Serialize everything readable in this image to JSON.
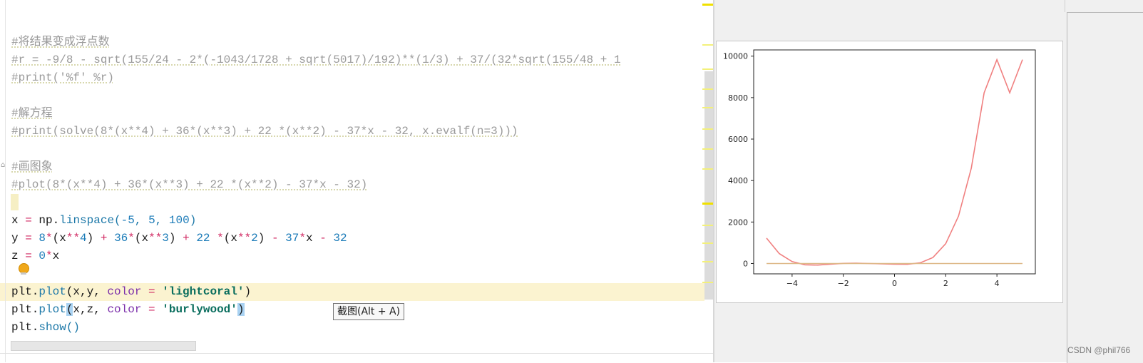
{
  "editor": {
    "code_lines": [
      [
        {
          "t": "",
          "c": "pl"
        }
      ],
      [
        {
          "t": "#将结果变成浮点数",
          "c": "cm"
        }
      ],
      [
        {
          "t": "#r = -9/8 - sqrt(155/24 - 2*(-1043/1728 + sqrt(5017)/192)**(1/3) + 37/(32*sqrt(155/48 + 1",
          "c": "cm"
        }
      ],
      [
        {
          "t": "#print('%f' %r)",
          "c": "cm"
        }
      ],
      [
        {
          "t": "",
          "c": "pl"
        }
      ],
      [
        {
          "t": "#解方程",
          "c": "cm"
        }
      ],
      [
        {
          "t": "#print(solve(8*(x**4) + 36*(x**3) + 22 *(x**2) - 37*x - 32, x.evalf(n=3)))",
          "c": "cm"
        }
      ],
      [
        {
          "t": "",
          "c": "pl"
        }
      ],
      [
        {
          "t": "#画图象",
          "c": "cm"
        }
      ],
      [
        {
          "t": "#plot(8*(x**4) + 36*(x**3) + 22 *(x**2) - 37*x - 32)",
          "c": "cm"
        }
      ],
      [
        {
          "t": "",
          "c": "pl"
        }
      ],
      [
        {
          "t": "x",
          "c": "pl"
        },
        {
          "t": " ",
          "c": "pl"
        },
        {
          "t": "=",
          "c": "op"
        },
        {
          "t": " np.",
          "c": "pl"
        },
        {
          "t": "linspace",
          "c": "fn"
        },
        {
          "t": "(",
          "c": "fn"
        },
        {
          "t": "-5",
          "c": "num"
        },
        {
          "t": ", ",
          "c": "fn"
        },
        {
          "t": "5",
          "c": "num"
        },
        {
          "t": ", ",
          "c": "fn"
        },
        {
          "t": "100",
          "c": "num"
        },
        {
          "t": ")",
          "c": "fn"
        }
      ],
      [
        {
          "t": "y",
          "c": "pl"
        },
        {
          "t": " = ",
          "c": "op"
        },
        {
          "t": "8",
          "c": "num"
        },
        {
          "t": "*",
          "c": "op"
        },
        {
          "t": "(x",
          "c": "pl"
        },
        {
          "t": "**",
          "c": "op"
        },
        {
          "t": "4",
          "c": "num"
        },
        {
          "t": ")",
          "c": "pl"
        },
        {
          "t": " + ",
          "c": "op"
        },
        {
          "t": "36",
          "c": "num"
        },
        {
          "t": "*",
          "c": "op"
        },
        {
          "t": "(x",
          "c": "pl"
        },
        {
          "t": "**",
          "c": "op"
        },
        {
          "t": "3",
          "c": "num"
        },
        {
          "t": ")",
          "c": "pl"
        },
        {
          "t": " + ",
          "c": "op"
        },
        {
          "t": "22",
          "c": "num"
        },
        {
          "t": " *",
          "c": "op"
        },
        {
          "t": "(x",
          "c": "pl"
        },
        {
          "t": "**",
          "c": "op"
        },
        {
          "t": "2",
          "c": "num"
        },
        {
          "t": ")",
          "c": "pl"
        },
        {
          "t": " - ",
          "c": "op"
        },
        {
          "t": "37",
          "c": "num"
        },
        {
          "t": "*",
          "c": "op"
        },
        {
          "t": "x",
          "c": "pl"
        },
        {
          "t": " - ",
          "c": "op"
        },
        {
          "t": "32",
          "c": "num"
        }
      ],
      [
        {
          "t": "z",
          "c": "pl"
        },
        {
          "t": " = ",
          "c": "op"
        },
        {
          "t": "0",
          "c": "num"
        },
        {
          "t": "*",
          "c": "op"
        },
        {
          "t": "x",
          "c": "pl"
        }
      ],
      [
        {
          "t": "",
          "c": "pl"
        }
      ],
      [
        {
          "t": "plt.",
          "c": "pl"
        },
        {
          "t": "plot",
          "c": "fn"
        },
        {
          "t": "(x,y, ",
          "c": "pl"
        },
        {
          "t": "color",
          "c": "param"
        },
        {
          "t": " = ",
          "c": "op"
        },
        {
          "t": "'lightcoral'",
          "c": "str"
        },
        {
          "t": ")",
          "c": "pl"
        }
      ],
      [
        {
          "t": "plt.",
          "c": "pl"
        },
        {
          "t": "plot",
          "c": "fn"
        },
        {
          "t": "(",
          "c": "bracket-hl"
        },
        {
          "t": "x,z, ",
          "c": "pl"
        },
        {
          "t": "color",
          "c": "param"
        },
        {
          "t": " = ",
          "c": "op"
        },
        {
          "t": "'burlywood'",
          "c": "str"
        },
        {
          "t": ")",
          "c": "bracket-hl"
        }
      ],
      [
        {
          "t": "plt.",
          "c": "pl"
        },
        {
          "t": "show",
          "c": "fn"
        },
        {
          "t": "()",
          "c": "fn"
        }
      ]
    ]
  },
  "tooltip": {
    "text": "截图(Alt + A)"
  },
  "watermark": {
    "text": "CSDN @phil766"
  },
  "chart_data": {
    "type": "line",
    "xlim": [
      -5.5,
      5.5
    ],
    "ylim": [
      -500,
      10300
    ],
    "xticks": [
      -4,
      -2,
      0,
      2,
      4
    ],
    "yticks": [
      0,
      2000,
      4000,
      6000,
      8000,
      10000
    ],
    "grid": false,
    "title": "",
    "xlabel": "",
    "ylabel": "",
    "series": [
      {
        "color": "#f08080",
        "x": [
          -5,
          -4.5,
          -4,
          -3.5,
          -3,
          -2.5,
          -2,
          -1.5,
          -1,
          -0.5,
          0,
          0.5,
          1,
          1.5,
          2,
          2.5,
          3,
          3.5,
          4,
          4.5,
          5
        ],
        "y": [
          1223,
          478.3,
          92,
          -63.3,
          -77,
          -34.8,
          6,
          11.5,
          -1,
          -14.3,
          -32,
          -39.8,
          29,
          288.5,
          954,
          2287.8,
          4597,
          8233.8,
          9833,
          8233.8,
          9833
        ]
      },
      {
        "color": "#deb887",
        "x": [
          -5,
          5
        ],
        "y": [
          0,
          0
        ]
      }
    ]
  }
}
